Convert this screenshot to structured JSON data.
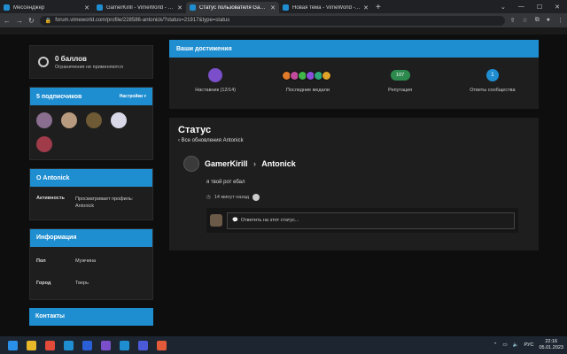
{
  "browser": {
    "tabs": [
      {
        "label": "Мессенджер",
        "color": "#1f8ed1",
        "active": false
      },
      {
        "label": "GamerKirill - VimeWorld - Фору...",
        "color": "#1f8ed1",
        "active": false
      },
      {
        "label": "Статус пользователя GamerKirill...",
        "color": "#1f8ed1",
        "active": true
      },
      {
        "label": "Новая тема - VimeWorld - Фору...",
        "color": "#1f8ed1",
        "active": false
      }
    ],
    "new_tab": "+",
    "url": "forum.vimeworld.com/profile/228586-antonick/?status=21917&type=status"
  },
  "sidebar": {
    "points": {
      "title": "0 баллов",
      "subtitle": "Ограничения не применяются"
    },
    "subscribers": {
      "title": "5 подписчиков",
      "settings": "Настройки ▾"
    },
    "about": {
      "title": "О Antonick",
      "activity_key": "Активность",
      "activity_val": "Просматривает профиль: Antonick"
    },
    "info": {
      "title": "Информация",
      "gender_key": "Пол",
      "gender_val": "Мужчина",
      "city_key": "Город",
      "city_val": "Тверь"
    },
    "contacts": {
      "title": "Контакты"
    }
  },
  "achievements": {
    "title": "Ваши достижения",
    "rank_label": "Наставник (12/14)",
    "medals_label": "Последние медали",
    "reputation_value": "107",
    "reputation_label": "Репутация",
    "answers_value": "1",
    "answers_label": "Ответы сообщества"
  },
  "status": {
    "title": "Статус",
    "back": "Все обновления Antonick",
    "from": "GamerKirill",
    "to": "Antonick",
    "text": "я твой рот ебал",
    "time": "14 минут назад",
    "reply_placeholder": "Ответить на этот статус..."
  },
  "taskbar": {
    "lang": "РУС",
    "time": "22:16",
    "date": "05.01.2023"
  }
}
